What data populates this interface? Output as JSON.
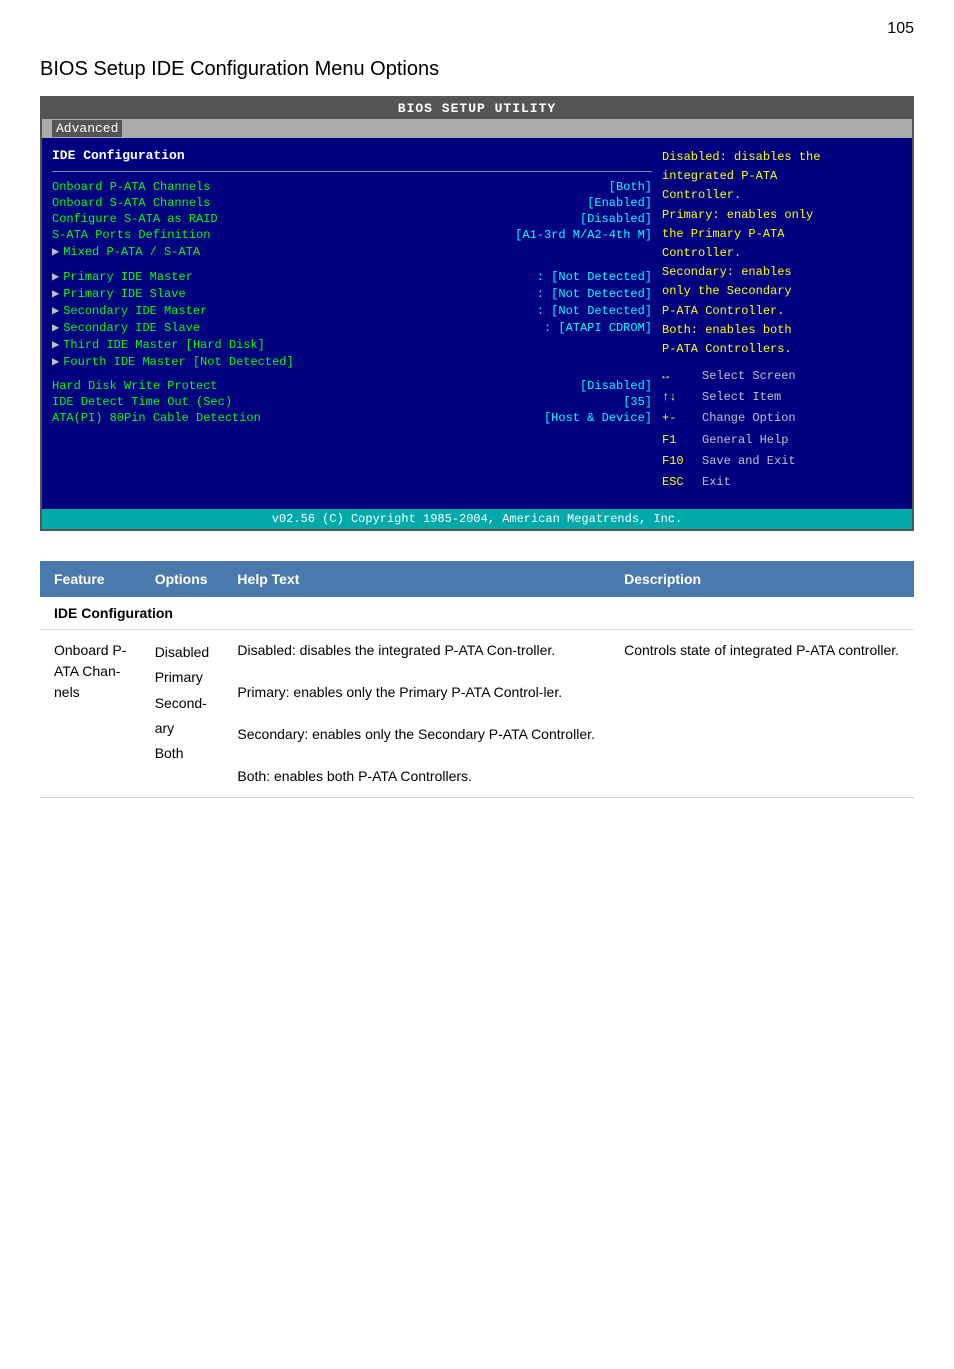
{
  "page": {
    "number": "105",
    "section_title": "BIOS Setup IDE Configuration Menu Options"
  },
  "bios": {
    "title": "BIOS SETUP UTILITY",
    "menu_tab": "Advanced",
    "section_header": "IDE Configuration",
    "rows": [
      {
        "label": "Onboard P-ATA Channels",
        "value": "[Both]"
      },
      {
        "label": "Onboard S-ATA Channels",
        "value": "[Enabled]"
      },
      {
        "label": "Configure S-ATA as RAID",
        "value": "[Disabled]"
      },
      {
        "label": "  S-ATA Ports Definition",
        "value": "[A1-3rd M/A2-4th M]",
        "indent": true
      }
    ],
    "mixed_item": "▶ Mixed P-ATA / S-ATA",
    "arrow_items": [
      {
        "label": "Primary IDE Master",
        "value": ": [Not Detected]"
      },
      {
        "label": "Primary IDE Slave",
        "value": ": [Not Detected]"
      },
      {
        "label": "Secondary IDE Master",
        "value": ": [Not Detected]"
      },
      {
        "label": "Secondary IDE Slave",
        "value": ": [ATAPI CDROM]"
      },
      {
        "label": "Third IDE Master [Hard Disk]",
        "value": ""
      },
      {
        "label": "Fourth IDE Master [Not Detected]",
        "value": ""
      }
    ],
    "bottom_rows": [
      {
        "label": "Hard Disk Write Protect",
        "value": "[Disabled]"
      },
      {
        "label": "IDE Detect Time Out (Sec)",
        "value": "[35]"
      },
      {
        "label": "ATA(PI) 80Pin Cable Detection",
        "value": "[Host & Device]"
      }
    ],
    "help_text": {
      "lines": [
        "Disabled: disables the",
        "integrated P-ATA",
        "Controller.",
        "Primary: enables only",
        "the Primary P-ATA",
        "Controller.",
        "Secondary: enables",
        "only the Secondary",
        "P-ATA Controller.",
        "Both: enables both",
        "P-ATA Controllers."
      ]
    },
    "key_bindings": [
      {
        "key": "↔",
        "desc": "Select Screen"
      },
      {
        "key": "↑↓",
        "desc": "Select Item"
      },
      {
        "key": "+-",
        "desc": "Change Option"
      },
      {
        "key": "F1",
        "desc": "General Help"
      },
      {
        "key": "F10",
        "desc": "Save and Exit"
      },
      {
        "key": "ESC",
        "desc": "Exit"
      }
    ],
    "footer": "v02.56 (C) Copyright 1985-2004, American Megatrends, Inc."
  },
  "table": {
    "headers": [
      "Feature",
      "Options",
      "Help Text",
      "Description"
    ],
    "section_row": "IDE Configuration",
    "data_rows": [
      {
        "feature": "Onboard P-ATA Chan-nels",
        "options": "Disabled\nPrimary\nSecond-ary\nBoth",
        "help_text": "Disabled: disables the integrated P-ATA Con-troller.\n\nPrimary: enables only the Primary P-ATA Control-ler.\n\nSecondary: enables only the Secondary P-ATA Controller.\n\nBoth: enables both P-ATA Controllers.",
        "description": "Controls state of integrated P-ATA controller."
      }
    ]
  }
}
